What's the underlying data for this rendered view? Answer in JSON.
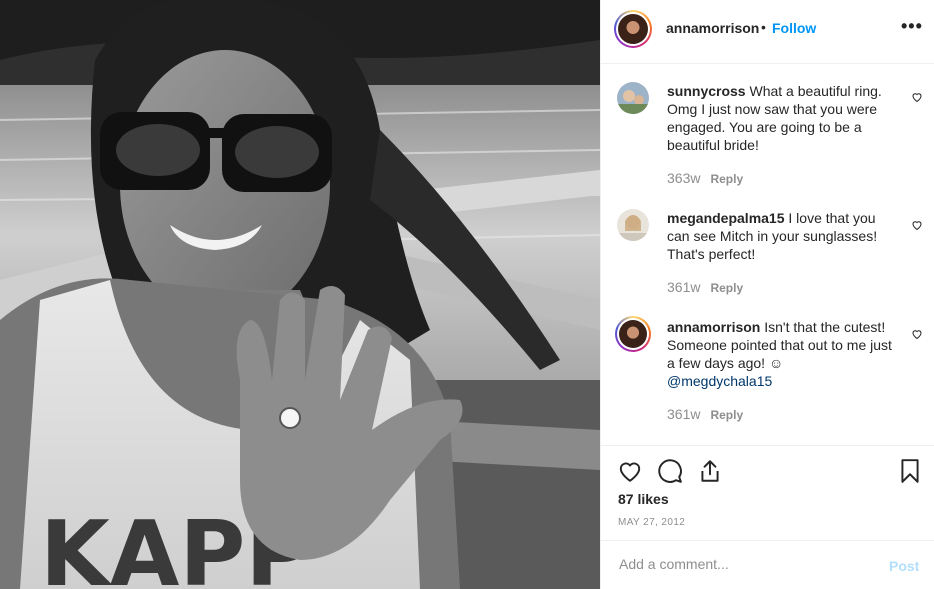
{
  "post": {
    "author": "annamorrison",
    "separator": "•",
    "follow_label": "Follow",
    "more_label": "•••",
    "photo_icon": "photo",
    "likes": "87 likes",
    "date": "MAY 27, 2012"
  },
  "comments": [
    {
      "user": "sunnycross",
      "text": " What a beautiful ring. Omg I just now saw that you were engaged. You are going to be a beautiful bride!",
      "age": "363w",
      "reply": "Reply"
    },
    {
      "user": "megandepalma15",
      "text": " I love that you can see Mitch in your sunglasses! That's perfect!",
      "age": "361w",
      "reply": "Reply"
    },
    {
      "user": "annamorrison",
      "text": " Isn't that the cutest! Someone pointed that out to me just a few days ago! ☺",
      "mention": "@megdychala15",
      "age": "361w",
      "reply": "Reply"
    }
  ],
  "composer": {
    "placeholder": "Add a comment...",
    "post_label": "Post"
  },
  "icons": {
    "like": "heart-icon",
    "comment": "comment-icon",
    "share": "share-icon",
    "save": "bookmark-icon",
    "comment_like": "heart-icon",
    "more": "more-icon"
  },
  "colors": {
    "follow": "#0095f6",
    "mention": "#00376b",
    "post_disabled": "#b2dffc",
    "muted": "#8e8e8e"
  }
}
